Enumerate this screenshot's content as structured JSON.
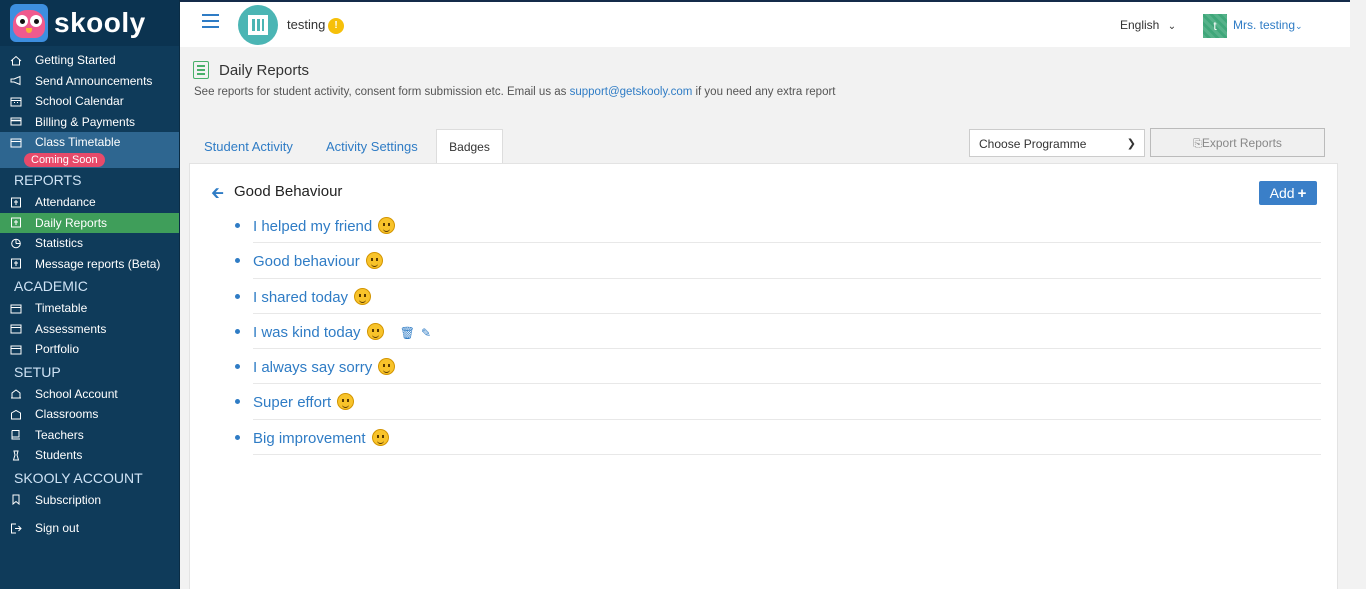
{
  "brand": {
    "name": "skooly"
  },
  "sidebar": {
    "items_top": [
      {
        "label": "Getting Started",
        "icon": "home-icon"
      },
      {
        "label": "Send Announcements",
        "icon": "megaphone-icon"
      },
      {
        "label": "School Calendar",
        "icon": "calendar-icon"
      },
      {
        "label": "Billing & Payments",
        "icon": "credit-card-icon"
      }
    ],
    "class_timetable": {
      "label": "Class Timetable",
      "badge": "Coming Soon"
    },
    "sections": {
      "reports": "REPORTS",
      "academic": "ACADEMIC",
      "setup": "SETUP",
      "account": "SKOOLY ACCOUNT"
    },
    "reports_items": [
      "Attendance",
      "Daily Reports",
      "Statistics",
      "Message reports (Beta)"
    ],
    "academic_items": [
      "Timetable",
      "Assessments",
      "Portfolio"
    ],
    "setup_items": [
      "School Account",
      "Classrooms",
      "Teachers",
      "Students"
    ],
    "account_items": [
      "Subscription"
    ],
    "signout": "Sign out"
  },
  "topbar": {
    "school_name": "testing",
    "warning_symbol": "!",
    "language": "English",
    "user_initial": "t",
    "user_name": "Mrs. testing"
  },
  "page": {
    "title": "Daily Reports",
    "desc_before": "See reports for student activity, consent form submission etc. Email us as ",
    "email": "support@getskooly.com",
    "desc_after": " if you need any extra report"
  },
  "tabs": [
    "Student Activity",
    "Activity Settings",
    "Badges"
  ],
  "active_tab": "Badges",
  "programme_select": {
    "value": "Choose Programme"
  },
  "export_label": "Export Reports",
  "group": {
    "title": "Good Behaviour",
    "add_label": "Add"
  },
  "badges": [
    "I helped my friend",
    "Good behaviour",
    "I shared today",
    "I was kind today",
    "I always say sorry",
    "Super effort",
    "Big improvement"
  ]
}
